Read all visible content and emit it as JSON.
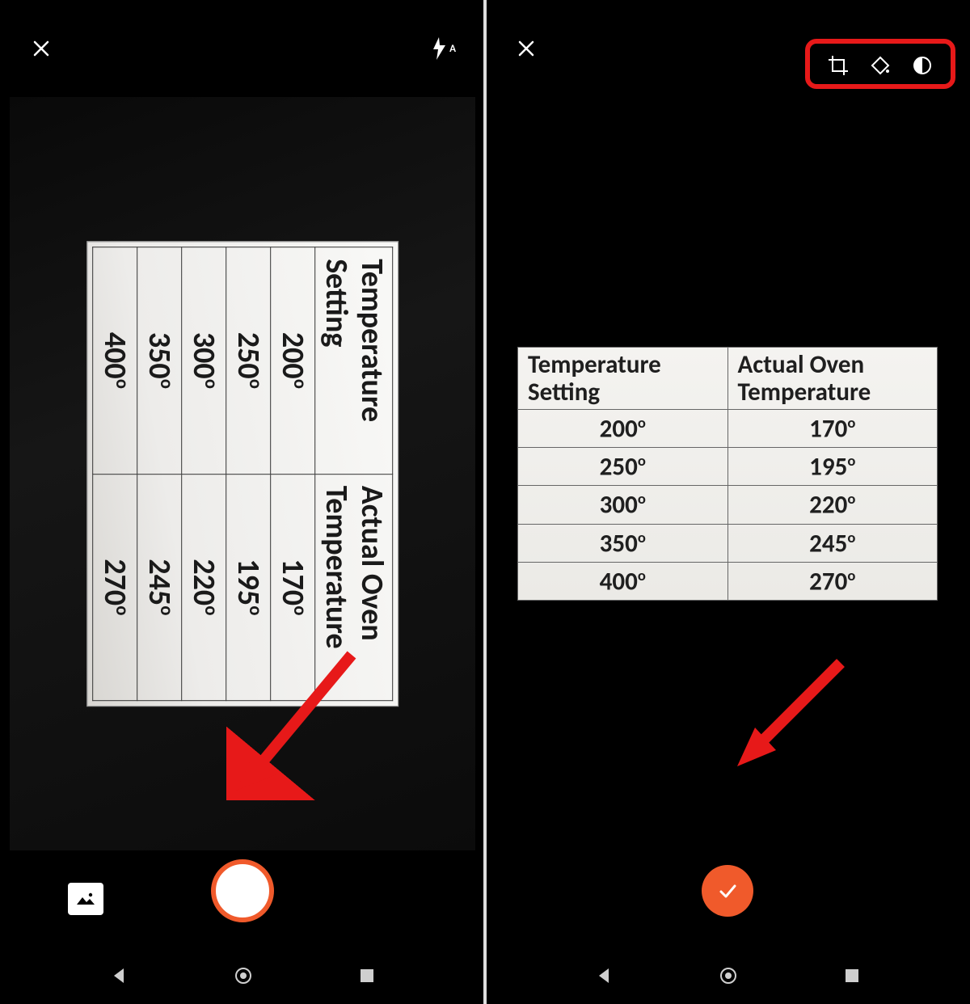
{
  "left_pane": {
    "topbar": {
      "close": "✕",
      "flash_mode": "A"
    },
    "table": {
      "header1_line1": "Temperature",
      "header1_line2": "Setting",
      "header2_line1": "Actual Oven",
      "header2_line2": "Temperature",
      "rows": [
        {
          "setting": "200",
          "actual": "170"
        },
        {
          "setting": "250",
          "actual": "195"
        },
        {
          "setting": "300",
          "actual": "220"
        },
        {
          "setting": "350",
          "actual": "245"
        },
        {
          "setting": "400",
          "actual": "270"
        }
      ]
    },
    "degree_mark": "o"
  },
  "right_pane": {
    "topbar": {
      "close": "✕"
    },
    "tools": {
      "crop": "crop",
      "ink": "ink",
      "contrast": "contrast"
    },
    "table": {
      "header1_line1": "Temperature",
      "header1_line2": "Setting",
      "header2_line1": "Actual Oven",
      "header2_line2": "Temperature",
      "rows": [
        {
          "setting": "200",
          "actual": "170"
        },
        {
          "setting": "250",
          "actual": "195"
        },
        {
          "setting": "300",
          "actual": "220"
        },
        {
          "setting": "350",
          "actual": "245"
        },
        {
          "setting": "400",
          "actual": "270"
        }
      ]
    },
    "degree_mark": "o"
  },
  "chart_data": {
    "type": "table",
    "title": "Temperature Setting vs Actual Oven Temperature",
    "columns": [
      "Temperature Setting",
      "Actual Oven Temperature"
    ],
    "rows": [
      [
        200,
        170
      ],
      [
        250,
        195
      ],
      [
        300,
        220
      ],
      [
        350,
        245
      ],
      [
        400,
        270
      ]
    ],
    "unit": "degrees"
  }
}
